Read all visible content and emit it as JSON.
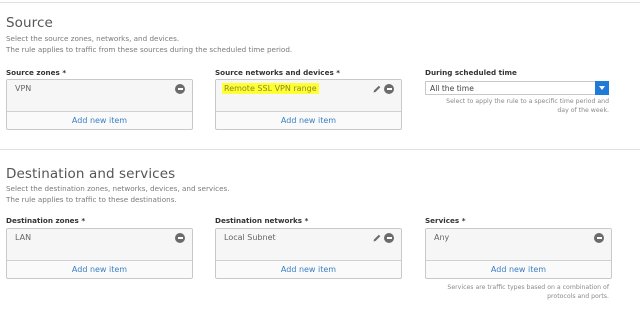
{
  "source": {
    "title": "Source",
    "desc_line1": "Select the source zones, networks, and devices.",
    "desc_line2": "The rule applies to traffic from these sources during the scheduled time period.",
    "zones": {
      "label": "Source zones",
      "required": "*",
      "item": "VPN",
      "add": "Add new item"
    },
    "networks": {
      "label": "Source networks and devices",
      "required": "*",
      "item": "Remote SSL VPN range",
      "add": "Add new item"
    },
    "schedule": {
      "label": "During scheduled time",
      "value": "All the time",
      "hint_line1": "Select to apply the rule to a specific time period and",
      "hint_line2": "day of the week."
    }
  },
  "destination": {
    "title": "Destination and services",
    "desc_line1": "Select the destination zones, networks, devices, and services.",
    "desc_line2": "The rule applies to traffic to these destinations.",
    "zones": {
      "label": "Destination zones",
      "required": "*",
      "item": "LAN",
      "add": "Add new item"
    },
    "networks": {
      "label": "Destination networks",
      "required": "*",
      "item": "Local Subnet",
      "add": "Add new item"
    },
    "services": {
      "label": "Services",
      "required": "*",
      "item": "Any",
      "add": "Add new item",
      "hint_line1": "Services are traffic types based on a combination of",
      "hint_line2": "protocols and ports."
    }
  },
  "colors": {
    "accent": "#1f7bd8",
    "link": "#3a7fc4",
    "highlight": "#ffff33"
  }
}
